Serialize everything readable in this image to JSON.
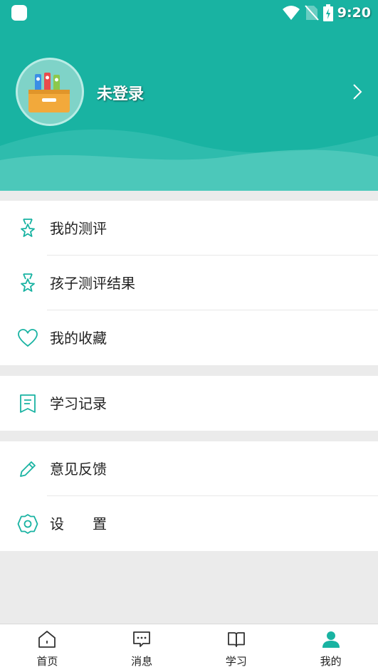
{
  "status_bar": {
    "time": "9:20"
  },
  "profile": {
    "name": "未登录"
  },
  "menu": {
    "my_evaluation": "我的测评",
    "child_results": "孩子测评结果",
    "favorites": "我的收藏",
    "study_records": "学习记录",
    "feedback": "意见反馈",
    "settings": "设　　置"
  },
  "tabs": [
    {
      "label": "首页",
      "icon": "home-icon"
    },
    {
      "label": "消息",
      "icon": "message-icon"
    },
    {
      "label": "学习",
      "icon": "book-icon"
    },
    {
      "label": "我的",
      "icon": "person-icon",
      "active": true
    }
  ],
  "colors": {
    "accent": "#19b3a2",
    "background": "#ebebeb",
    "text": "#222222"
  }
}
